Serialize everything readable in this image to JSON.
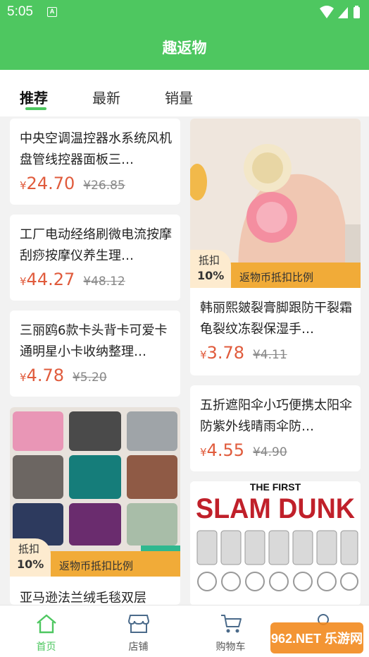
{
  "status_bar": {
    "time": "5:05",
    "notification_badge": "A"
  },
  "header": {
    "title": "趣返物",
    "color": "#4ec760"
  },
  "tabs": [
    {
      "label": "推荐",
      "active": true
    },
    {
      "label": "最新",
      "active": false
    },
    {
      "label": "销量",
      "active": false
    }
  ],
  "products_left": [
    {
      "name": "中央空调温控器水系统风机盘管线控器面板三…",
      "currency": "¥",
      "price": "24.70",
      "old_price": "¥26.85"
    },
    {
      "name": "工厂电动经络刷微电流按摩刮痧按摩仪养生理…",
      "currency": "¥",
      "price": "44.27",
      "old_price": "¥48.12"
    },
    {
      "name": "三丽鸥6款卡头背卡可爱卡通明星小卡收纳整理…",
      "currency": "¥",
      "price": "4.78",
      "old_price": "¥5.20"
    },
    {
      "name": "亚马逊法兰绒毛毯双层",
      "badge_label": "抵扣",
      "badge_percent": "10%",
      "badge_text": "返物币抵扣比例",
      "image": "blanket-photo"
    }
  ],
  "products_right": [
    {
      "name": "韩丽熙皴裂膏脚跟防干裂霜龟裂纹冻裂保湿手…",
      "currency": "¥",
      "price": "3.78",
      "old_price": "¥4.11",
      "badge_label": "抵扣",
      "badge_percent": "10%",
      "badge_text": "返物币抵扣比例",
      "image": "cream-jars-photo"
    },
    {
      "name": "五折遮阳伞小巧便携太阳伞防紫外线晴雨伞防…",
      "currency": "¥",
      "price": "4.55",
      "old_price": "¥4.90"
    },
    {
      "name": "",
      "image": "slam-dunk-keychains-photo",
      "image_text": [
        "THE FIRST",
        "SLAM DUNK"
      ]
    }
  ],
  "bottom_nav": [
    {
      "label": "首页",
      "icon": "home-icon",
      "active": true
    },
    {
      "label": "店铺",
      "icon": "store-icon",
      "active": false
    },
    {
      "label": "购物车",
      "icon": "cart-icon",
      "active": false
    },
    {
      "label": "",
      "icon": "profile-icon",
      "active": false
    }
  ],
  "watermark": "962.NET 乐游网"
}
